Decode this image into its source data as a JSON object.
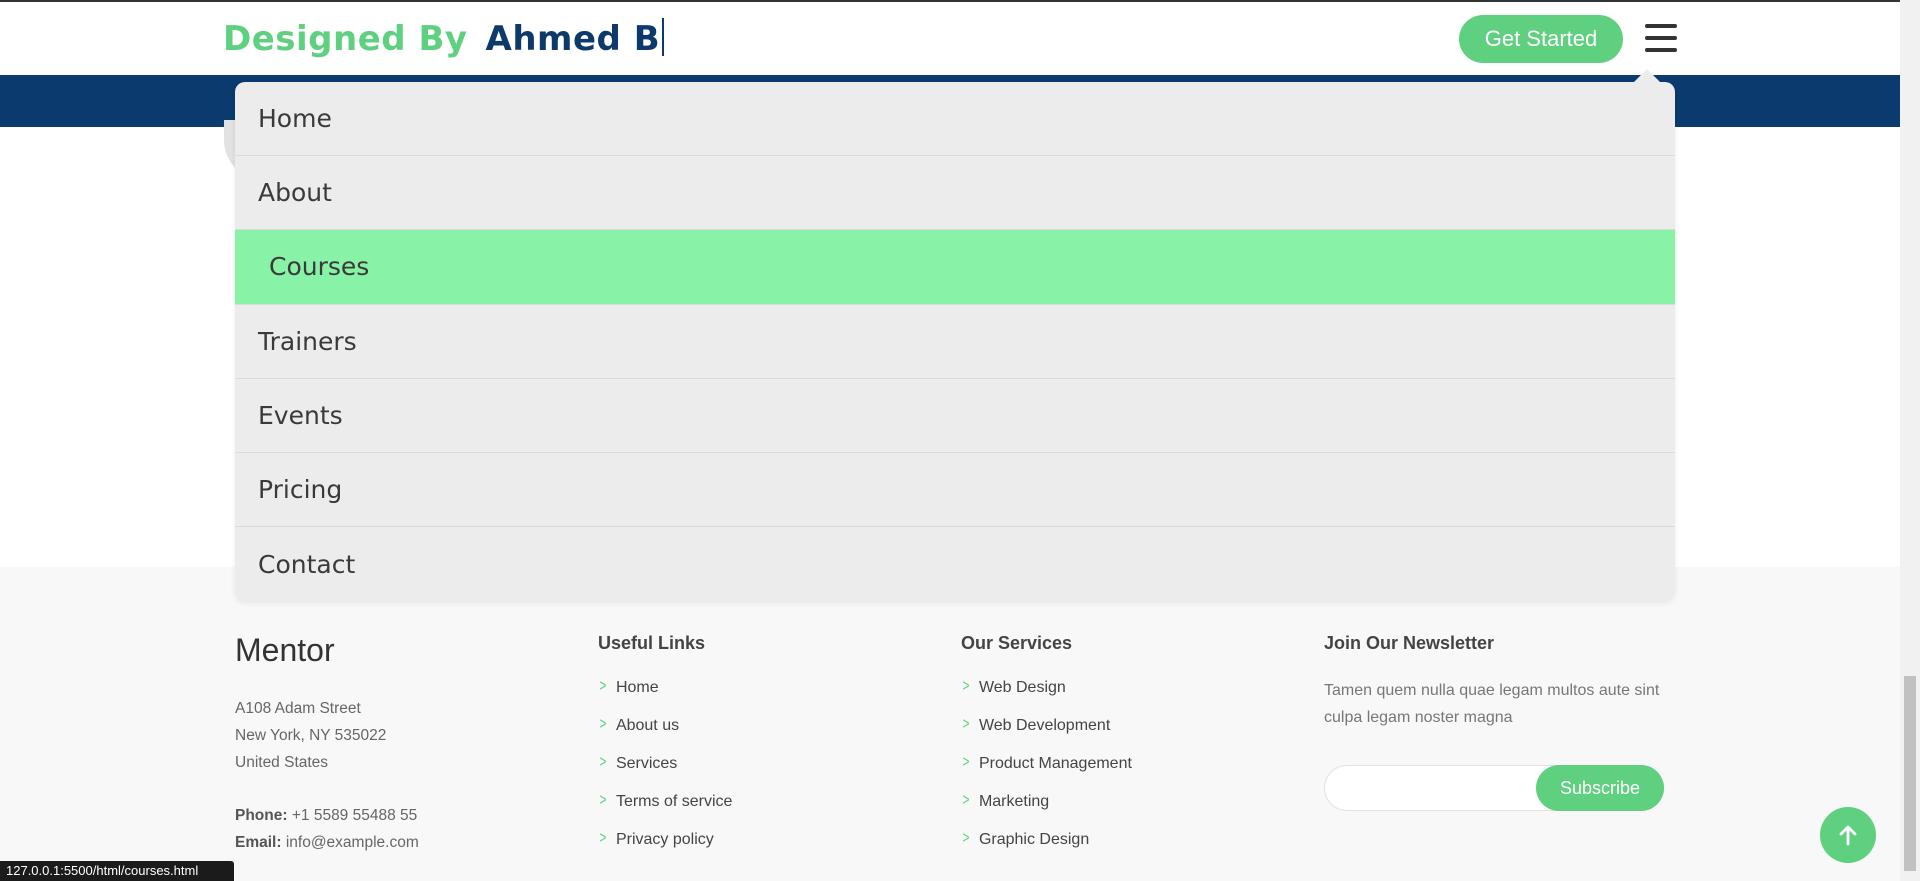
{
  "header": {
    "logo_prefix": "Designed By",
    "logo_name": "Ahmed B",
    "cta_label": "Get Started",
    "menu_icon": "hamburger-icon"
  },
  "nav": {
    "items": [
      {
        "label": "Home"
      },
      {
        "label": "About"
      },
      {
        "label": "Courses"
      },
      {
        "label": "Trainers"
      },
      {
        "label": "Events"
      },
      {
        "label": "Pricing"
      },
      {
        "label": "Contact"
      }
    ],
    "active": "Courses"
  },
  "footer": {
    "brand": "Mentor",
    "address": [
      "A108 Adam Street",
      "New York, NY 535022",
      "United States"
    ],
    "phone_label": "Phone:",
    "phone": "+1 5589 55488 55",
    "email_label": "Email:",
    "email": "info@example.com",
    "useful_links": {
      "title": "Useful Links",
      "items": [
        "Home",
        "About us",
        "Services",
        "Terms of service",
        "Privacy policy"
      ]
    },
    "services": {
      "title": "Our Services",
      "items": [
        "Web Design",
        "Web Development",
        "Product Management",
        "Marketing",
        "Graphic Design"
      ]
    },
    "newsletter": {
      "title": "Join Our Newsletter",
      "text": "Tamen quem nulla quae legam multos aute sint culpa legam noster magna",
      "input_value": "",
      "button_label": "Subscribe"
    }
  },
  "status_bar": {
    "url": "127.0.0.1:5500/html/courses.html"
  },
  "colors": {
    "accent": "#5fcf80",
    "brand_blue": "#0b3a6e",
    "active_item": "#88f2a6",
    "dropdown_bg": "#ececec"
  }
}
